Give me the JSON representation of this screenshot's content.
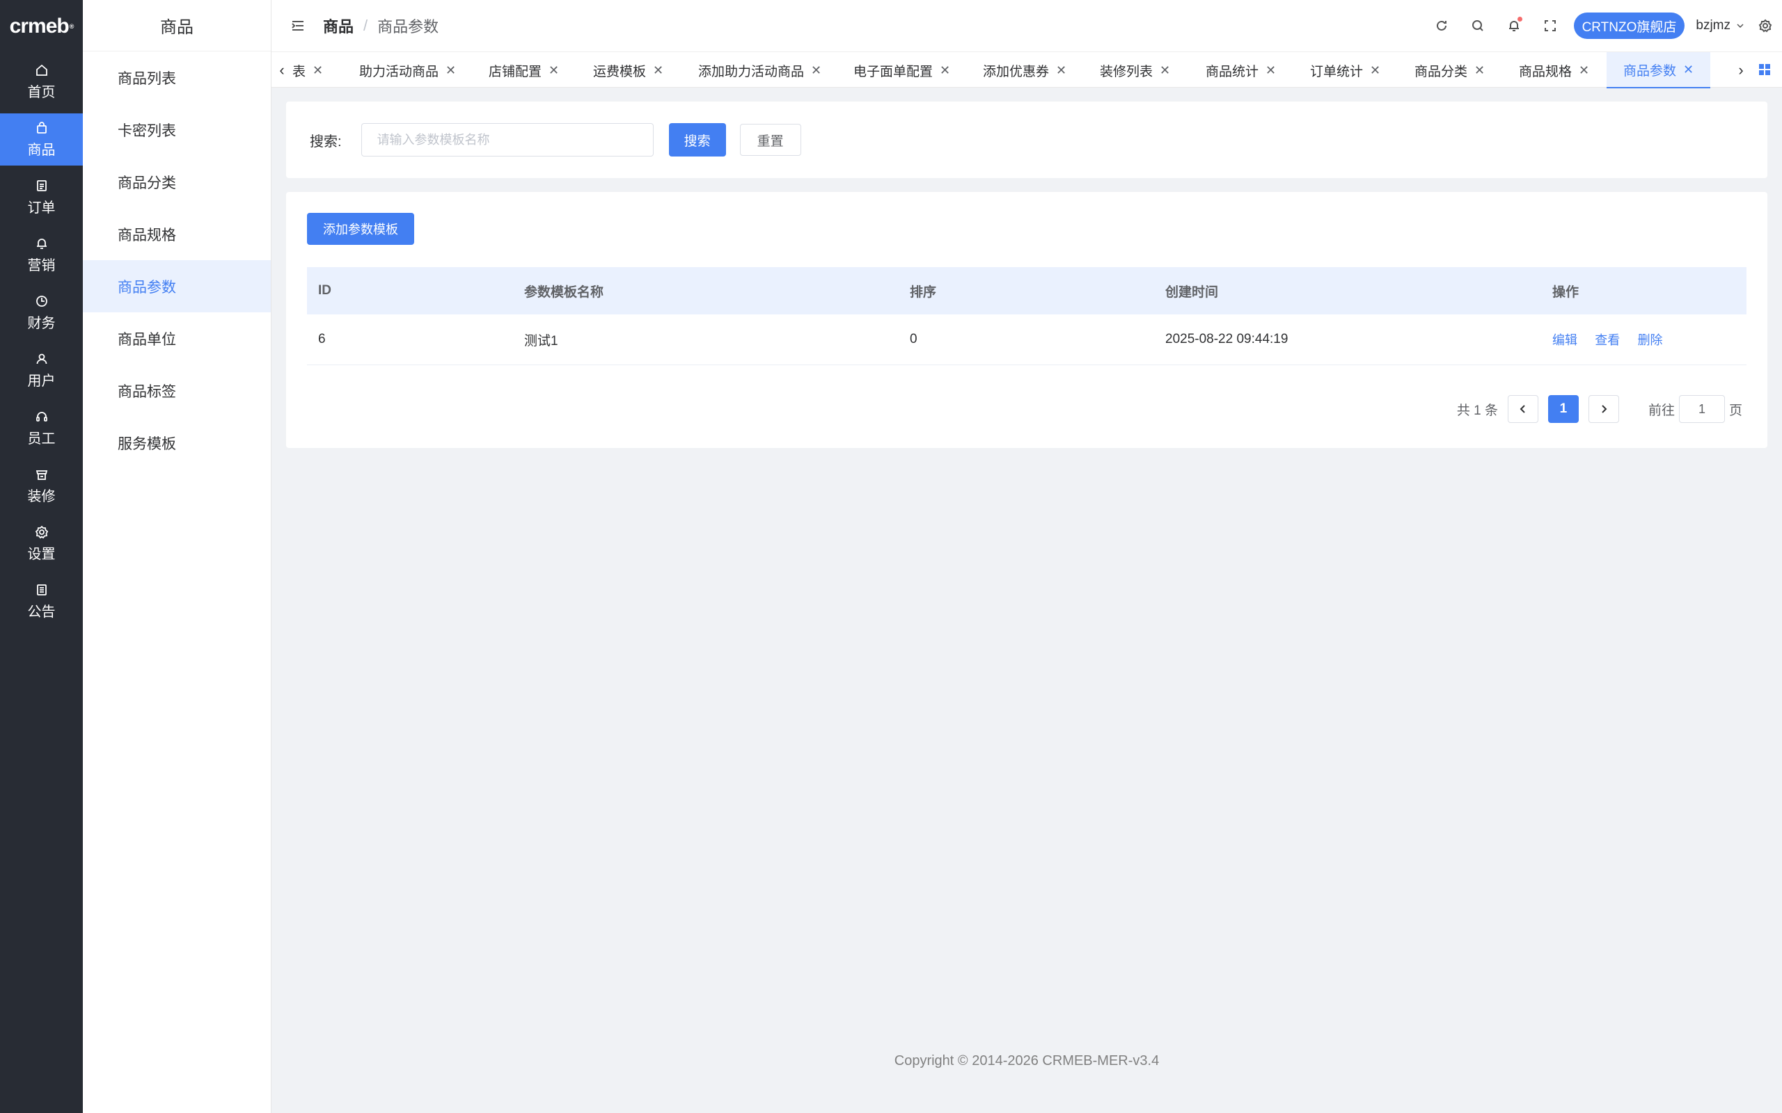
{
  "app": {
    "logo": "crmeb",
    "logo_mark": "®"
  },
  "rail": {
    "items": [
      {
        "label": "首页",
        "icon": "home-icon"
      },
      {
        "label": "商品",
        "icon": "bag-icon",
        "active": true
      },
      {
        "label": "订单",
        "icon": "document-icon"
      },
      {
        "label": "营销",
        "icon": "bell-icon"
      },
      {
        "label": "财务",
        "icon": "clock-icon"
      },
      {
        "label": "用户",
        "icon": "user-icon"
      },
      {
        "label": "员工",
        "icon": "headset-icon"
      },
      {
        "label": "装修",
        "icon": "shop-icon"
      },
      {
        "label": "设置",
        "icon": "gear-icon"
      },
      {
        "label": "公告",
        "icon": "notice-icon"
      }
    ]
  },
  "submenu": {
    "title": "商品",
    "items": [
      {
        "label": "商品列表"
      },
      {
        "label": "卡密列表"
      },
      {
        "label": "商品分类"
      },
      {
        "label": "商品规格"
      },
      {
        "label": "商品参数",
        "active": true
      },
      {
        "label": "商品单位"
      },
      {
        "label": "商品标签"
      },
      {
        "label": "服务模板"
      }
    ]
  },
  "header": {
    "breadcrumb": [
      "商品",
      "商品参数"
    ],
    "separator": "/",
    "store_name": "CRTNZO旗舰店",
    "username": "bzjmz"
  },
  "tabs": [
    {
      "label": "表"
    },
    {
      "label": "助力活动商品"
    },
    {
      "label": "店铺配置"
    },
    {
      "label": "运费模板"
    },
    {
      "label": "添加助力活动商品"
    },
    {
      "label": "电子面单配置"
    },
    {
      "label": "添加优惠券"
    },
    {
      "label": "装修列表"
    },
    {
      "label": "商品统计"
    },
    {
      "label": "订单统计"
    },
    {
      "label": "商品分类"
    },
    {
      "label": "商品规格"
    },
    {
      "label": "商品参数",
      "active": true
    }
  ],
  "search": {
    "label": "搜索:",
    "placeholder": "请输入参数模板名称",
    "value": "",
    "search_button": "搜索",
    "reset_button": "重置"
  },
  "table": {
    "add_button": "添加参数模板",
    "columns": [
      "ID",
      "参数模板名称",
      "排序",
      "创建时间",
      "操作"
    ],
    "rows": [
      {
        "id": "6",
        "name": "测试1",
        "sort": "0",
        "created": "2025-08-22 09:44:19",
        "actions": [
          "编辑",
          "查看",
          "删除"
        ]
      }
    ]
  },
  "pagination": {
    "total": "共 1 条",
    "current": "1",
    "goto_prefix": "前往",
    "goto_value": "1",
    "goto_suffix": "页"
  },
  "footer": "Copyright © 2014-2026 CRMEB-MER-v3.4",
  "colors": {
    "accent": "#437ff2",
    "rail_bg": "#282c34",
    "page_bg": "#f0f2f5"
  }
}
